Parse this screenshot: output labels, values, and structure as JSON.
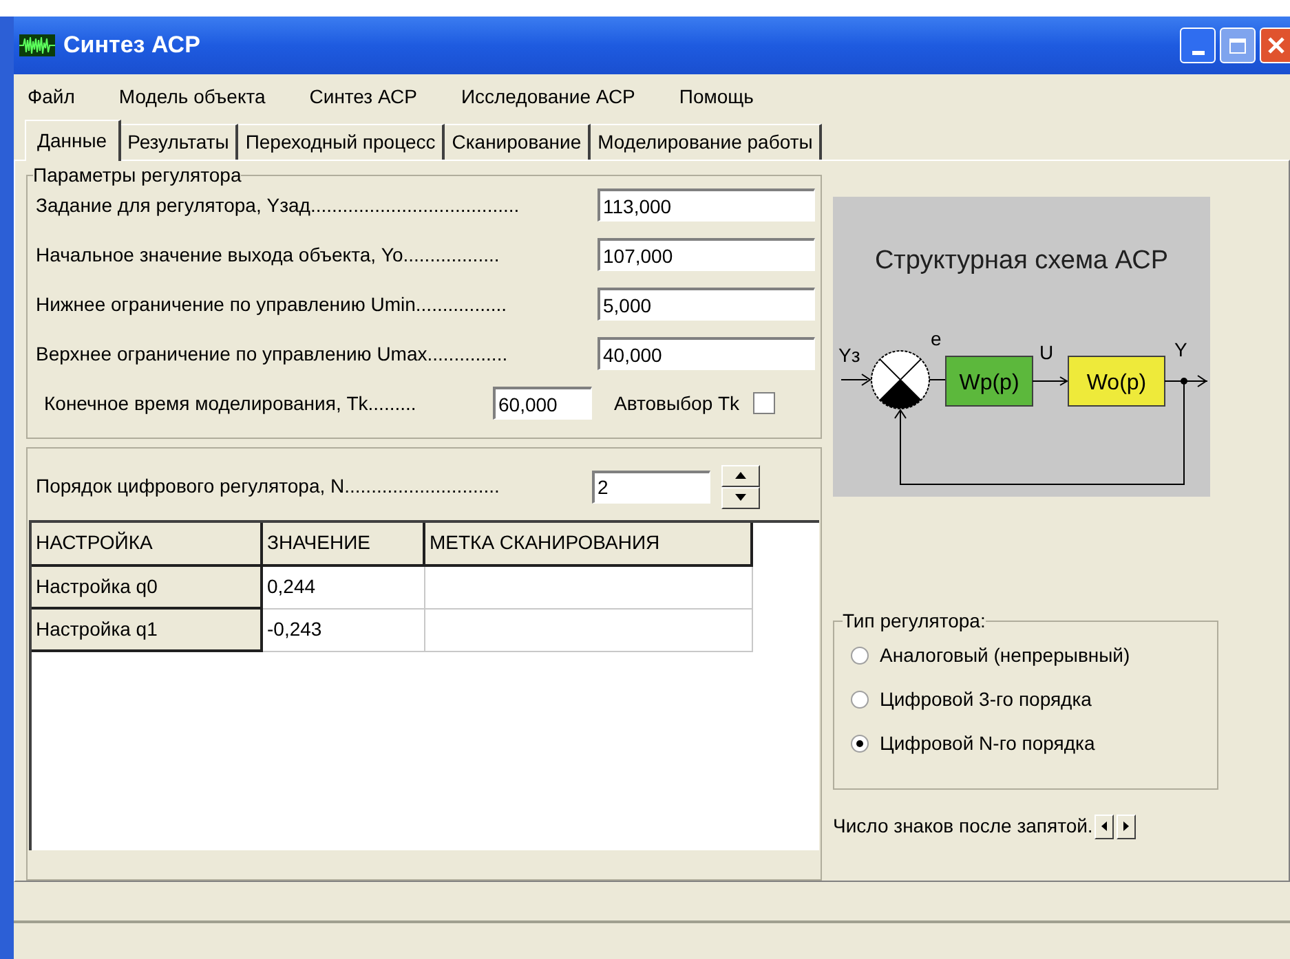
{
  "window": {
    "title": "Синтез АСР"
  },
  "menu": [
    "Файл",
    "Модель объекта",
    "Синтез АСР",
    "Исследование АСР",
    "Помощь"
  ],
  "tabs": [
    {
      "label": "Данные",
      "selected": true
    },
    {
      "label": "Результаты",
      "selected": false
    },
    {
      "label": "Переходный процесс",
      "selected": false
    },
    {
      "label": "Сканирование",
      "selected": false
    },
    {
      "label": "Моделирование работы",
      "selected": false
    }
  ],
  "params": {
    "title": "Параметры регулятора",
    "fields": [
      {
        "label": "Задание для регулятора, Yзад.......................................",
        "value": "113,000"
      },
      {
        "label": "Начальное значение выхода объекта, Yo..................",
        "value": "107,000"
      },
      {
        "label": "Нижнее ограничение по управлению Umin.................",
        "value": "5,000"
      },
      {
        "label": "Верхнее ограничение по управлению Umax...............",
        "value": "40,000"
      }
    ],
    "end_time": {
      "label": "Конечное время моделирования, Tk.........",
      "value": "60,000"
    },
    "auto": {
      "label": "Автовыбор Tk",
      "checked": false
    }
  },
  "order": {
    "label": "Порядок цифрового регулятора, N.............................",
    "value": "2"
  },
  "table": {
    "columns": [
      "НАСТРОЙКА",
      "ЗНАЧЕНИЕ",
      "МЕТКА СКАНИРОВАНИЯ"
    ],
    "rows": [
      {
        "name": "Настройка q0",
        "value": "0,244"
      },
      {
        "name": "Настройка q1",
        "value": "-0,243"
      }
    ]
  },
  "diagram": {
    "title": "Структурная схема АСР",
    "input": "Yз",
    "error": "e",
    "control": "U",
    "output": "Y",
    "blocks": [
      {
        "label": "Wp(p)",
        "color": "#5cb83c"
      },
      {
        "label": "Wo(p)",
        "color": "#eeea3a"
      }
    ]
  },
  "regulator_type": {
    "title": "Тип регулятора:",
    "options": [
      {
        "label": "Аналоговый (непрерывный)",
        "selected": false
      },
      {
        "label": "Цифровой 3-го порядка",
        "selected": false
      },
      {
        "label": "Цифровой N-го порядка",
        "selected": true
      }
    ]
  },
  "decimals": {
    "label": "Число знаков после запятой."
  }
}
